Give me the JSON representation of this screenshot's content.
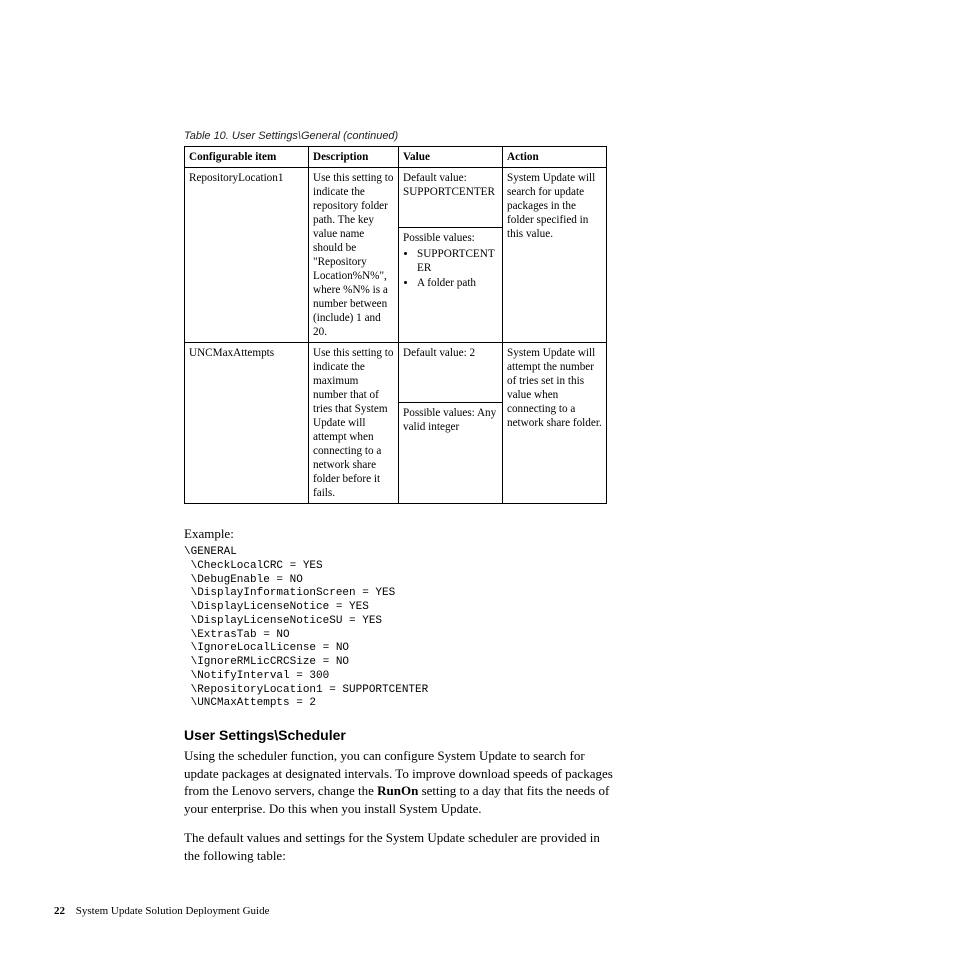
{
  "table": {
    "caption": "Table 10. User Settings\\General (continued)",
    "headers": {
      "item": "Configurable item",
      "desc": "Description",
      "value": "Value",
      "action": "Action"
    },
    "rows": [
      {
        "item": "RepositoryLocation1",
        "desc": "Use this setting to indicate the repository folder path. The key value name should be \"Repository Location%N%\", where %N% is a number between (include) 1 and 20.",
        "value_default": "Default value: SUPPORTCENTER",
        "value_possible_label": "Possible values:",
        "value_possible_items": [
          "SUPPORTCENTER",
          "A folder path"
        ],
        "action": "System Update will search for update packages in the folder specified in this value."
      },
      {
        "item": "UNCMaxAttempts",
        "desc": "Use this setting to indicate the maximum number that of tries that System Update will attempt when connecting to a network share folder before it fails.",
        "value_default": "Default value: 2",
        "value_possible": "Possible values: Any valid integer",
        "action": "System Update will attempt the number of tries set in this value when connecting to a network share folder."
      }
    ]
  },
  "example": {
    "label": "Example:",
    "code": "\\GENERAL\n \\CheckLocalCRC = YES\n \\DebugEnable = NO\n \\DisplayInformationScreen = YES\n \\DisplayLicenseNotice = YES\n \\DisplayLicenseNoticeSU = YES\n \\ExtrasTab = NO\n \\IgnoreLocalLicense = NO\n \\IgnoreRMLicCRCSize = NO\n \\NotifyInterval = 300\n \\RepositoryLocation1 = SUPPORTCENTER\n \\UNCMaxAttempts = 2"
  },
  "section": {
    "heading": "User Settings\\Scheduler",
    "para1_a": "Using the scheduler function, you can configure System Update to search for update packages at designated intervals. To improve download speeds of packages from the Lenovo servers, change the ",
    "para1_bold": "RunOn",
    "para1_b": " setting to a day that fits the needs of your enterprise. Do this when you install System Update.",
    "para2": "The default values and settings for the System Update scheduler are provided in the following table:"
  },
  "footer": {
    "page": "22",
    "title": "System Update Solution Deployment Guide"
  }
}
